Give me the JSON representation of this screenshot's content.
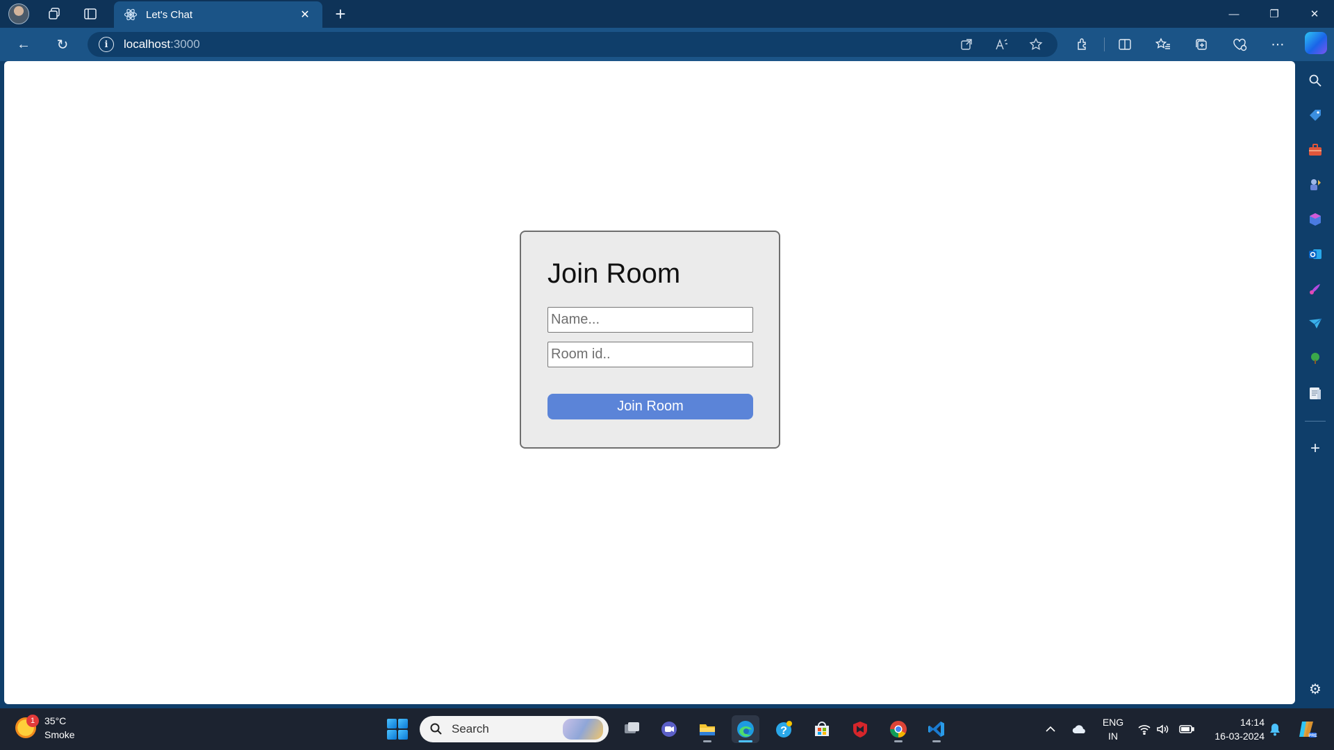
{
  "browser": {
    "tab": {
      "title": "Let's Chat",
      "close_glyph": "✕"
    },
    "new_tab_glyph": "+",
    "window_controls": {
      "minimize": "—",
      "restore": "❐",
      "close": "✕"
    },
    "nav": {
      "back_glyph": "←",
      "refresh_glyph": "↻"
    },
    "address": {
      "host": "localhost",
      "port": ":3000",
      "info_glyph": "i"
    },
    "address_icons": [
      "popout-icon",
      "read-aloud-icon",
      "favorite-star-icon"
    ],
    "toolbar_icons": [
      "extensions-icon",
      "split-screen-icon",
      "favorites-icon",
      "collections-icon",
      "browser-essentials-icon",
      "more-icon",
      "copilot-icon"
    ]
  },
  "join_form": {
    "title": "Join Room",
    "name_placeholder": "Name...",
    "room_placeholder": "Room id..",
    "submit_label": "Join Room",
    "accent": "#5b84d8"
  },
  "sidebar": {
    "icons": [
      "search-icon",
      "shopping-tag-icon",
      "tools-icon",
      "games-icon",
      "microsoft-365-icon",
      "outlook-icon",
      "designer-icon",
      "send-icon",
      "tree-icon",
      "notes-icon"
    ],
    "add_glyph": "+",
    "settings_glyph": "⚙"
  },
  "taskbar": {
    "weather": {
      "temp": "35°C",
      "condition": "Smoke",
      "badge": "1"
    },
    "search_label": "Search",
    "apps": [
      "task-view",
      "teams-chat",
      "file-explorer",
      "edge",
      "help",
      "microsoft-store",
      "mcafee",
      "chrome",
      "vscode"
    ],
    "language": {
      "line1": "ENG",
      "line2": "IN"
    },
    "clock": {
      "time": "14:14",
      "date": "16-03-2024"
    }
  }
}
